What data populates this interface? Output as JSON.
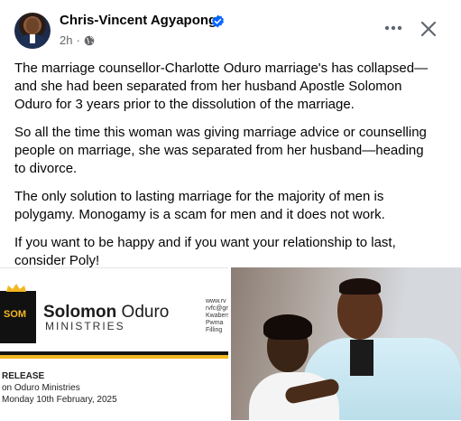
{
  "post": {
    "author": "Chris-Vincent Agyapong",
    "time": "2h",
    "separator": "·",
    "paragraphs": [
      "The marriage counsellor-Charlotte Oduro marriage's has collapsed— and she had been separated from her husband Apostle Solomon Oduro for 3 years prior to the dissolution of the marriage.",
      "So all the time this woman was giving marriage advice or counselling people on marriage, she was separated from her husband—heading to divorce.",
      "The only solution to lasting marriage for the majority of men is polygamy. Monogamy is a scam for men and it does not work.",
      "If you want to be happy and if you want your relationship to last, consider Poly!"
    ]
  },
  "media": {
    "doc": {
      "logo_letters": "SOM",
      "brand_bold": "Solomon",
      "brand_rest": " Oduro",
      "brand_sub": "MINISTRIES",
      "contact": [
        "www.rv",
        "rvfc@gm",
        "",
        "Kwabers",
        "Pwma Filling"
      ],
      "release_lines": [
        "RELEASE",
        "on Oduro Ministries",
        "Monday 10th February, 2025"
      ]
    }
  },
  "icons": {
    "verified": "verified-badge-icon",
    "globe": "globe-icon",
    "more": "more-options-icon",
    "close": "close-icon"
  },
  "colors": {
    "verified_blue": "#0866ff",
    "meta_gray": "#65676b",
    "brand_gold": "#f2b722"
  }
}
